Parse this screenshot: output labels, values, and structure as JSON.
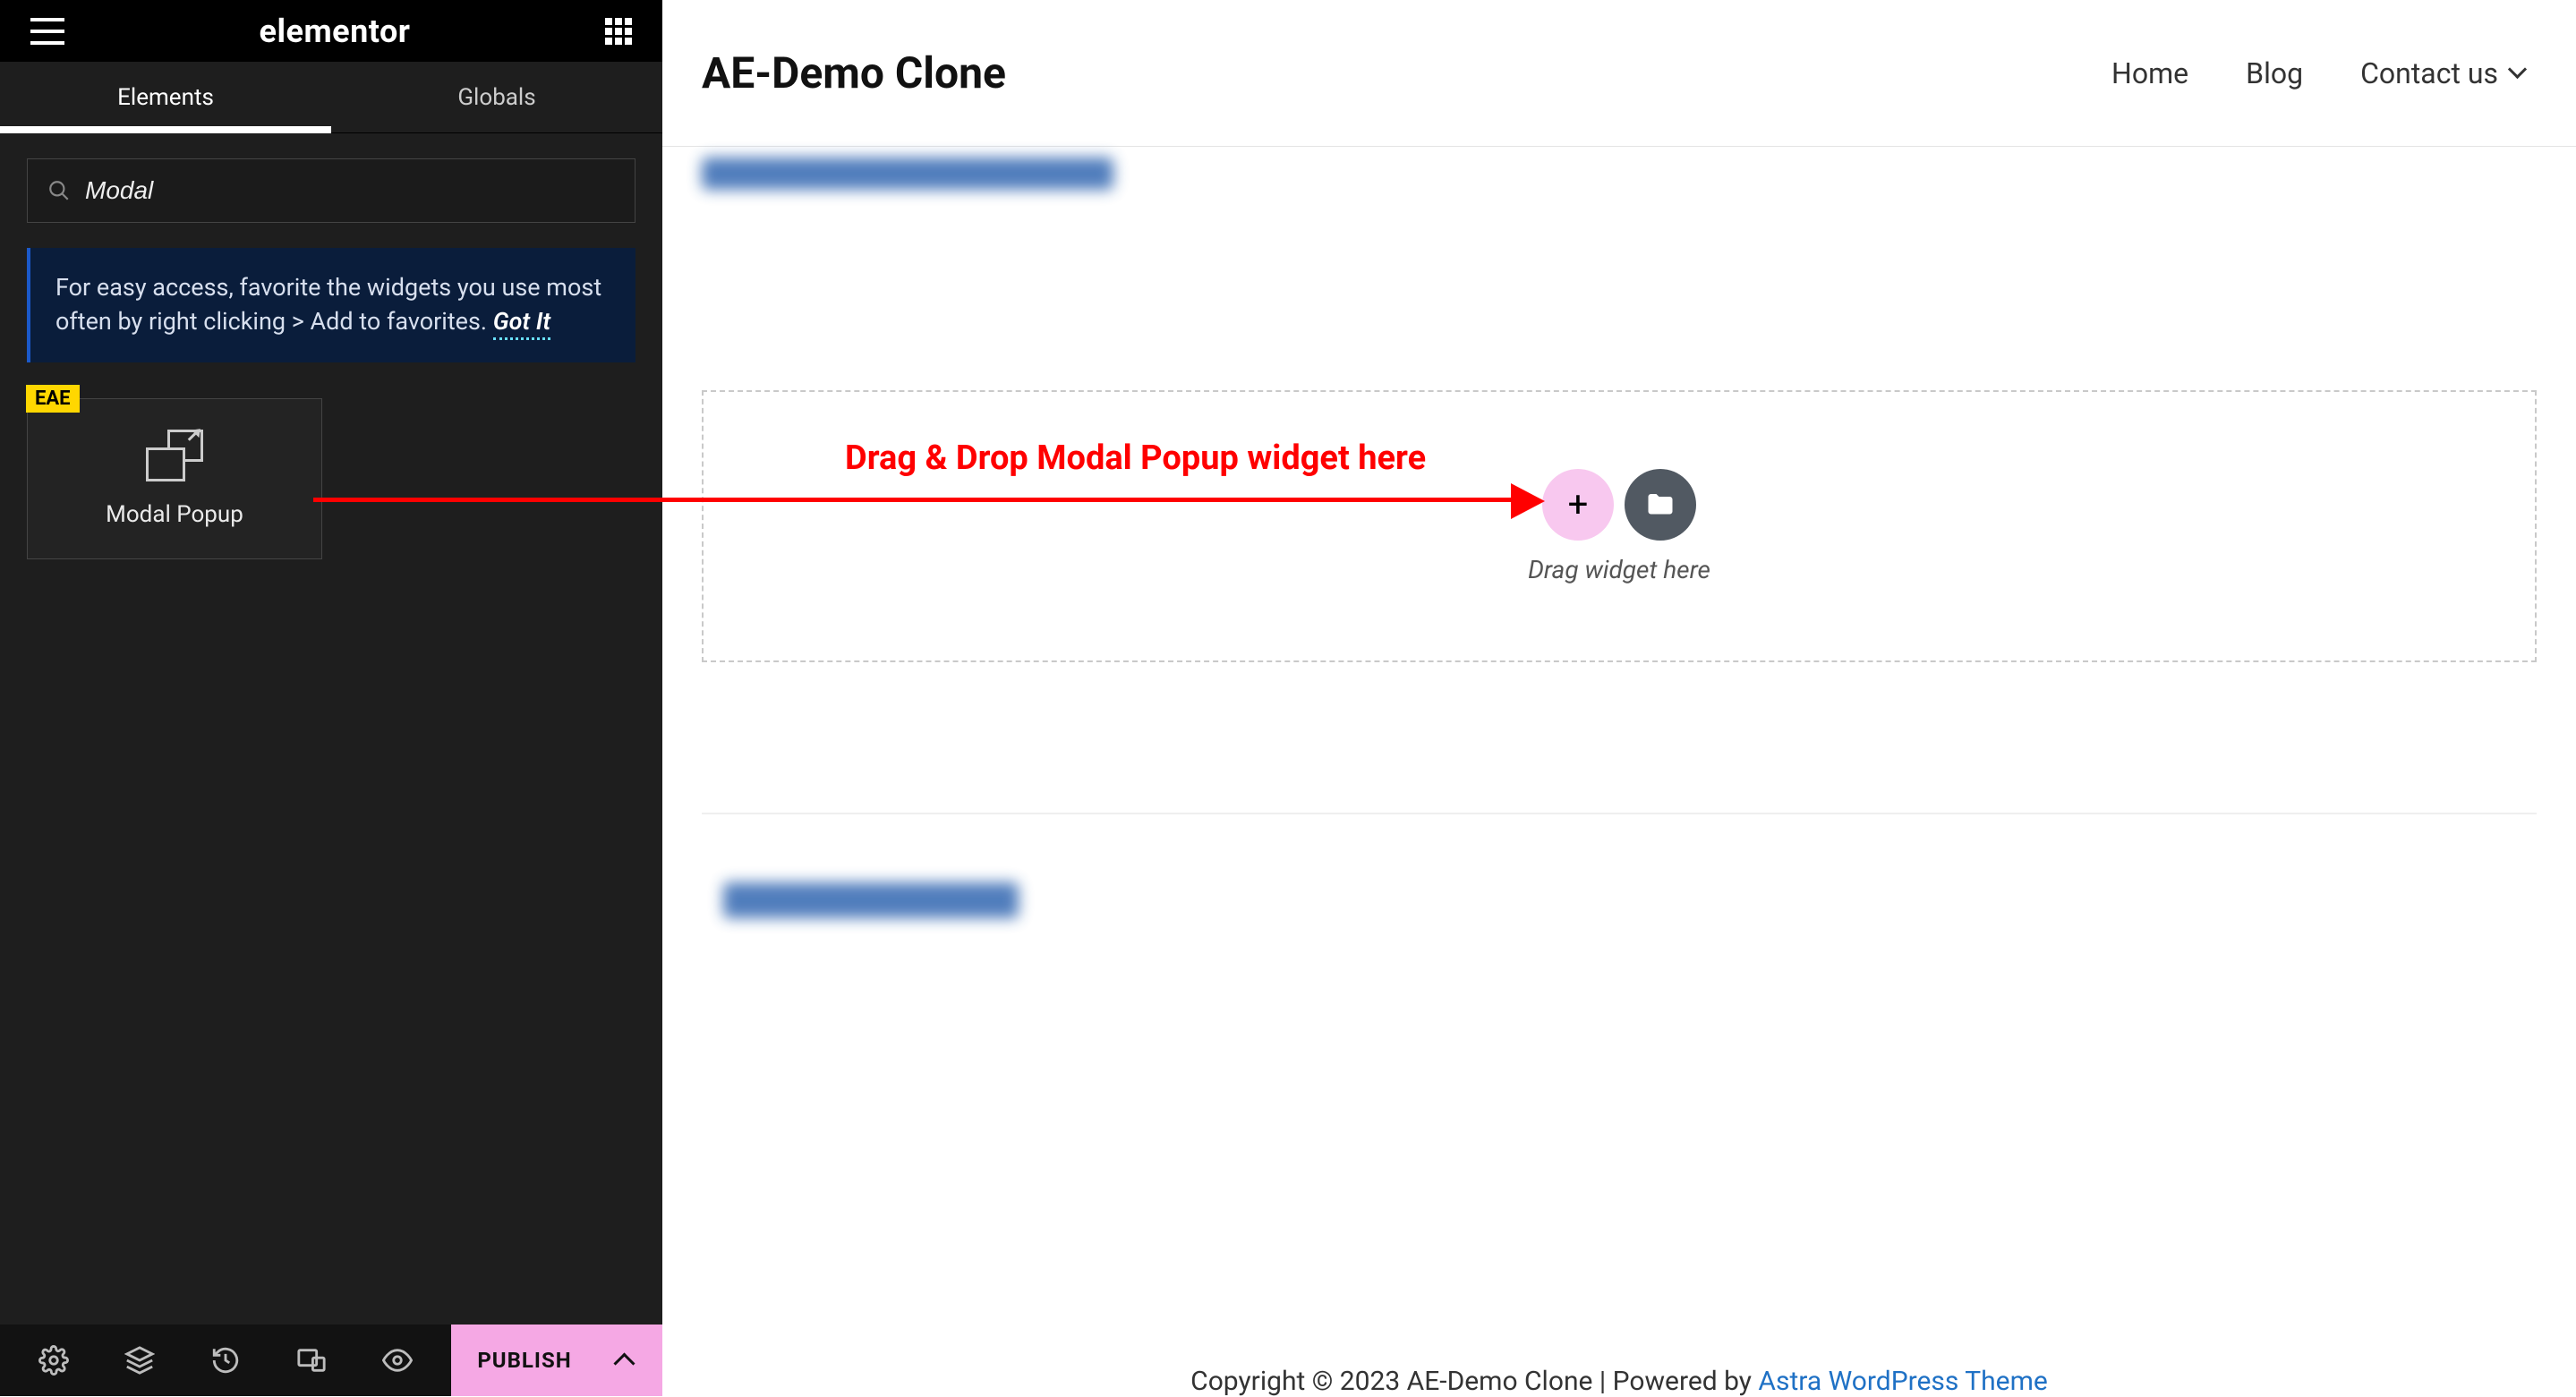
{
  "sidebar": {
    "brand": "elementor",
    "tabs": {
      "elements": "Elements",
      "globals": "Globals"
    },
    "search": {
      "value": "Modal"
    },
    "tip": {
      "text": "For easy access, favorite the widgets you use most often by right clicking > Add to favorites.",
      "gotit": "Got It"
    },
    "widget": {
      "badge": "EAE",
      "label": "Modal Popup"
    },
    "footer": {
      "publish": "PUBLISH"
    }
  },
  "preview": {
    "site_title": "AE-Demo Clone",
    "nav": {
      "home": "Home",
      "blog": "Blog",
      "contact": "Contact us"
    },
    "drop_label": "Drag widget here",
    "footer_text": "Copyright © 2023 AE-Demo Clone | Powered by ",
    "footer_link": "Astra WordPress Theme"
  },
  "annotation": {
    "text": "Drag & Drop Modal Popup widget here"
  }
}
